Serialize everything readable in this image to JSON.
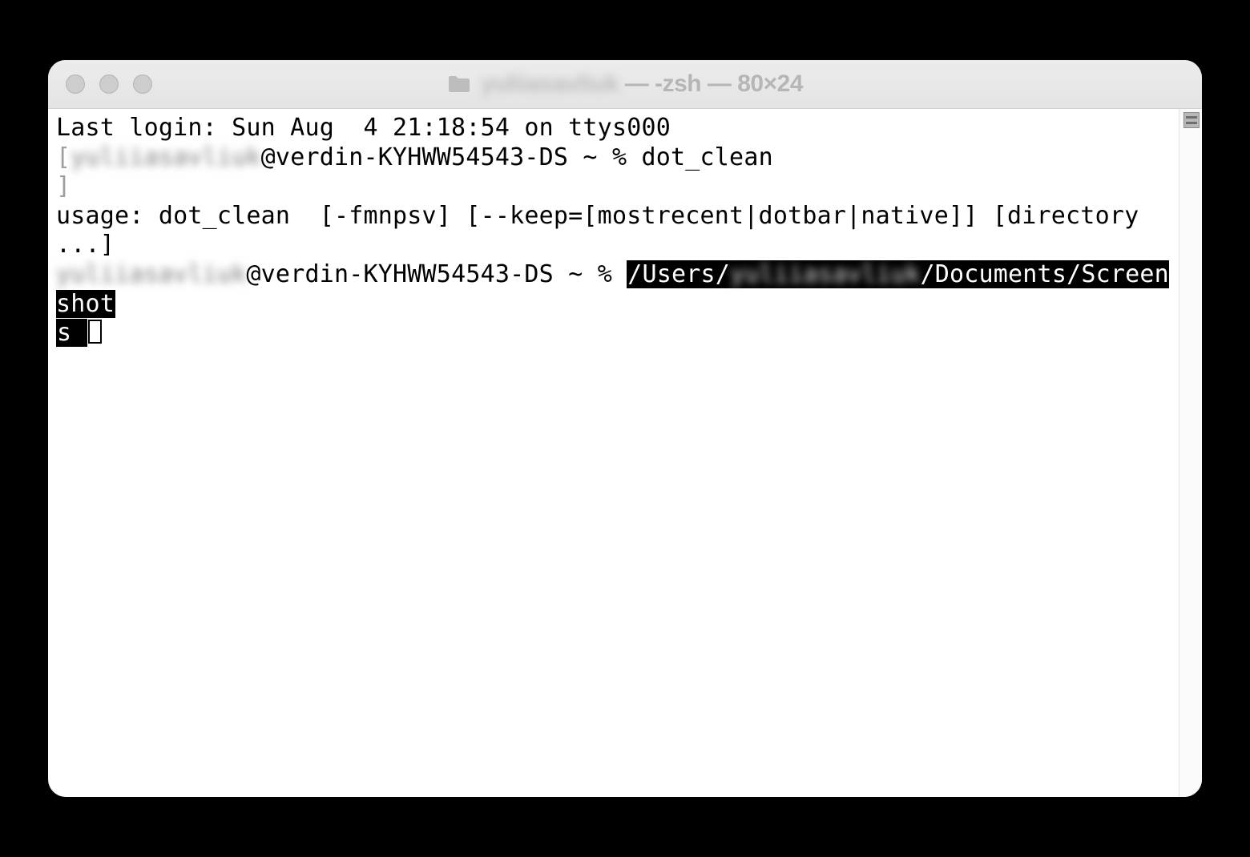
{
  "window": {
    "title_user": "yuliiasavliuk",
    "title_suffix": " — -zsh — 80×24"
  },
  "terminal": {
    "last_login": "Last login: Sun Aug  4 21:18:54 on ttys000",
    "user": "yuliiasavliuk",
    "host": "@verdin-KYHWW54543-DS",
    "prompt_tail": " ~ % ",
    "cmd1": "dot_clean",
    "usage": "usage: dot_clean  [-fmnpsv] [--keep=[mostrecent|dotbar|native]] [directory ...]",
    "sel_pre": "/Users/",
    "sel_user": "yuliiasavliuk",
    "sel_post": "/Documents/Screenshot",
    "sel_wrap": "s "
  }
}
